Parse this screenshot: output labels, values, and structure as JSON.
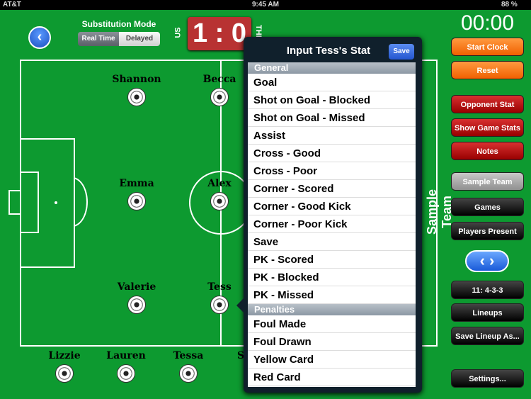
{
  "status": {
    "carrier": "AT&T",
    "time": "9:45 AM",
    "battery": "88 %"
  },
  "header": {
    "sub_mode_title": "Substitution Mode",
    "seg_real_time": "Real Time",
    "seg_delayed": "Delayed",
    "selected": "Real Time",
    "score": "1 : 0",
    "home_label": "US",
    "away_label": "THE"
  },
  "clock": "00:00",
  "buttons": {
    "start_clock": "Start Clock",
    "reset": "Reset",
    "opponent_stat": "Opponent Stat",
    "show_game_stats": "Show Game Stats",
    "notes": "Notes",
    "sample_team": "Sample Team",
    "games": "Games",
    "players_present": "Players Present",
    "formation": "11: 4-3-3",
    "lineups": "Lineups",
    "save_lineup": "Save Lineup As...",
    "settings": "Settings..."
  },
  "team_label": "Sample Team",
  "players": [
    "Shannon",
    "Becca",
    "Emma",
    "Alex",
    "Valerie",
    "Tess"
  ],
  "bench": [
    "Lizzie",
    "Lauren",
    "Tessa",
    "S"
  ],
  "popover": {
    "title": "Input Tess's Stat",
    "save": "Save",
    "sections": [
      {
        "title": "General",
        "items": [
          "Goal",
          "Shot on Goal - Blocked",
          "Shot on Goal - Missed",
          "Assist",
          "Cross - Good",
          "Cross - Poor",
          "Corner - Scored",
          "Corner - Good Kick",
          "Corner - Poor Kick",
          "Save",
          "PK - Scored",
          "PK - Blocked",
          "PK - Missed"
        ]
      },
      {
        "title": "Penalties",
        "items": [
          "Foul Made",
          "Foul Drawn",
          "Yellow Card",
          "Red Card"
        ]
      }
    ]
  },
  "colors": {
    "field": "#0d9a30",
    "score_bg": "#b83232",
    "orange": "#f06000",
    "red": "#980000"
  }
}
